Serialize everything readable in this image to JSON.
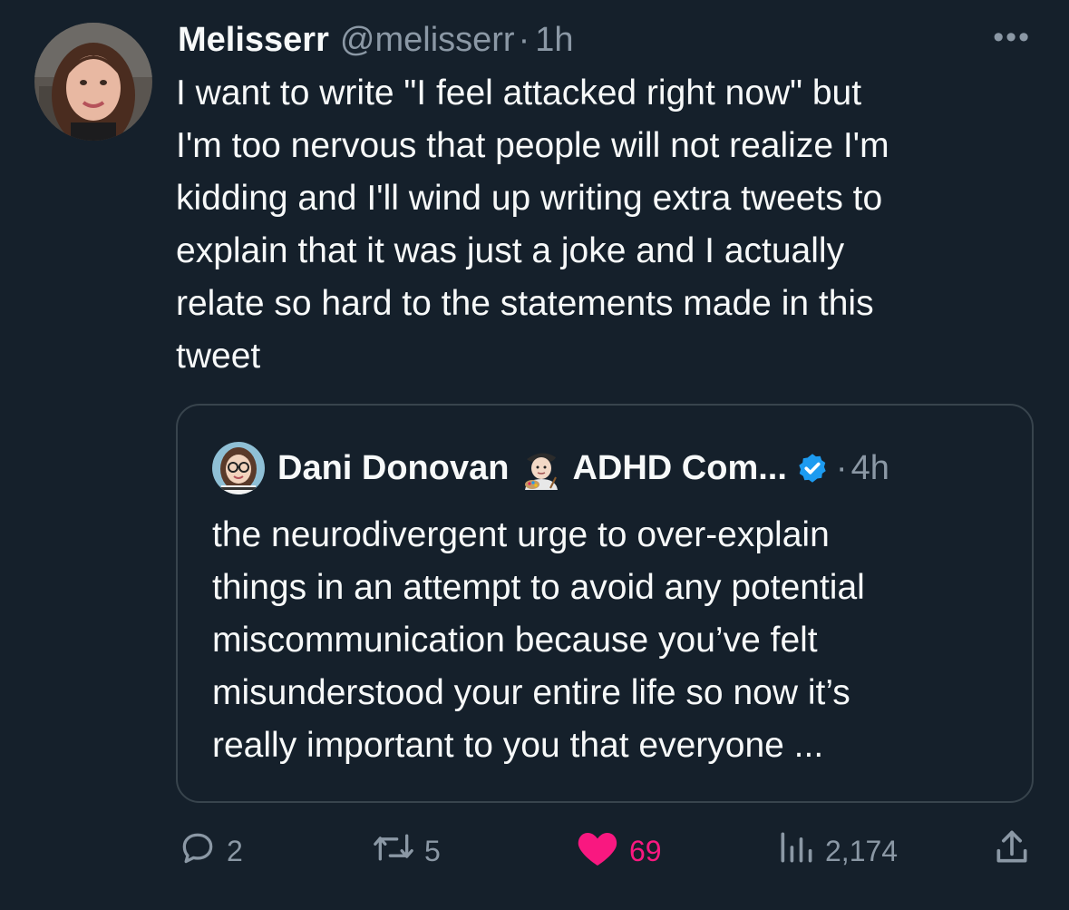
{
  "tweet": {
    "author_name": "Melisserr",
    "author_handle": "@melisserr",
    "separator": "·",
    "time": "1h",
    "more_label": "•••",
    "text": "I want to write \"I feel attacked right now\" but\nI'm too nervous that people will not realize I'm\nkidding and I'll wind up writing extra tweets to\nexplain that it was just a joke and I actually\nrelate so hard to the statements made in this\ntweet"
  },
  "quote": {
    "author_name": "Dani Donovan",
    "author_name_suffix": "ADHD Com...",
    "emoji": "artist-emoji",
    "separator": "·",
    "time": "4h",
    "text": "the neurodivergent urge to over-explain\nthings in an attempt to avoid any potential\nmiscommunication because you’ve felt\nmisunderstood your entire life so now it’s\nreally important to you that everyone ..."
  },
  "actions": {
    "reply_count": "2",
    "retweet_count": "5",
    "like_count": "69",
    "views_count": "2,174"
  },
  "colors": {
    "background": "#15202b",
    "text": "#f7f9f9",
    "secondary": "#8b98a5",
    "like": "#f91880",
    "verified": "#1d9bf0",
    "border": "#38444d"
  }
}
